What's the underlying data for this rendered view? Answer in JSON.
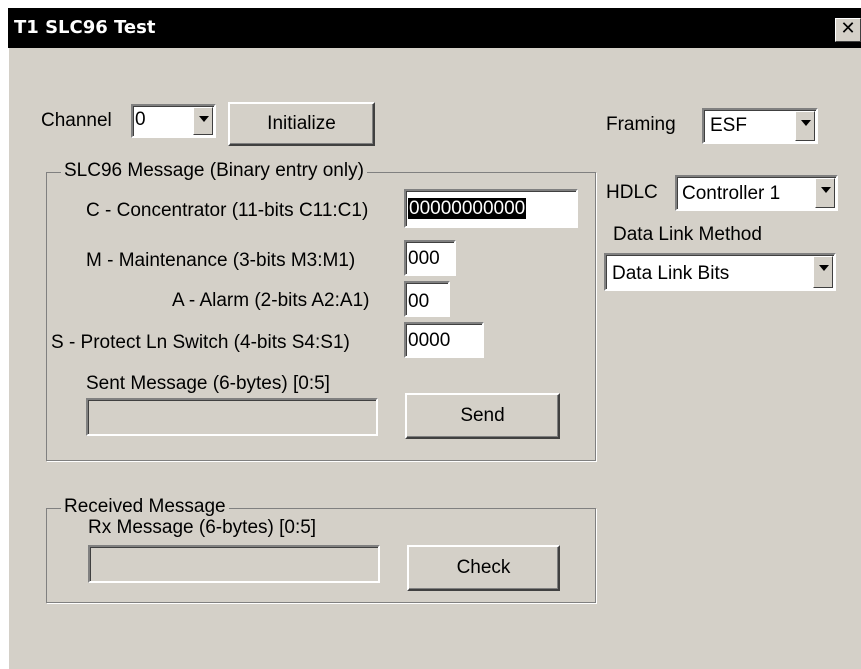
{
  "window": {
    "title": "T1 SLC96 Test",
    "close_glyph": "✕"
  },
  "channel": {
    "label": "Channel",
    "value": "0"
  },
  "initialize_button": "Initialize",
  "framing": {
    "label": "Framing",
    "value": "ESF"
  },
  "hdlc": {
    "label": "HDLC",
    "value": "Controller 1"
  },
  "data_link": {
    "label": "Data Link Method",
    "value": "Data Link Bits"
  },
  "slc_group": {
    "title": "SLC96 Message (Binary entry only)",
    "c_label": "C - Concentrator (11-bits C11:C1)",
    "c_value": "00000000000",
    "m_label": "M - Maintenance (3-bits M3:M1)",
    "m_value": "000",
    "a_label": "A - Alarm (2-bits A2:A1)",
    "a_value": "00",
    "s_label": "S - Protect Ln Switch (4-bits S4:S1)",
    "s_value": "0000",
    "sent_label": "Sent Message (6-bytes) [0:5]",
    "sent_value": "",
    "send_button": "Send"
  },
  "rx_group": {
    "title": "Received Message",
    "rx_label": "Rx Message (6-bytes) [0:5]",
    "rx_value": "",
    "check_button": "Check"
  }
}
